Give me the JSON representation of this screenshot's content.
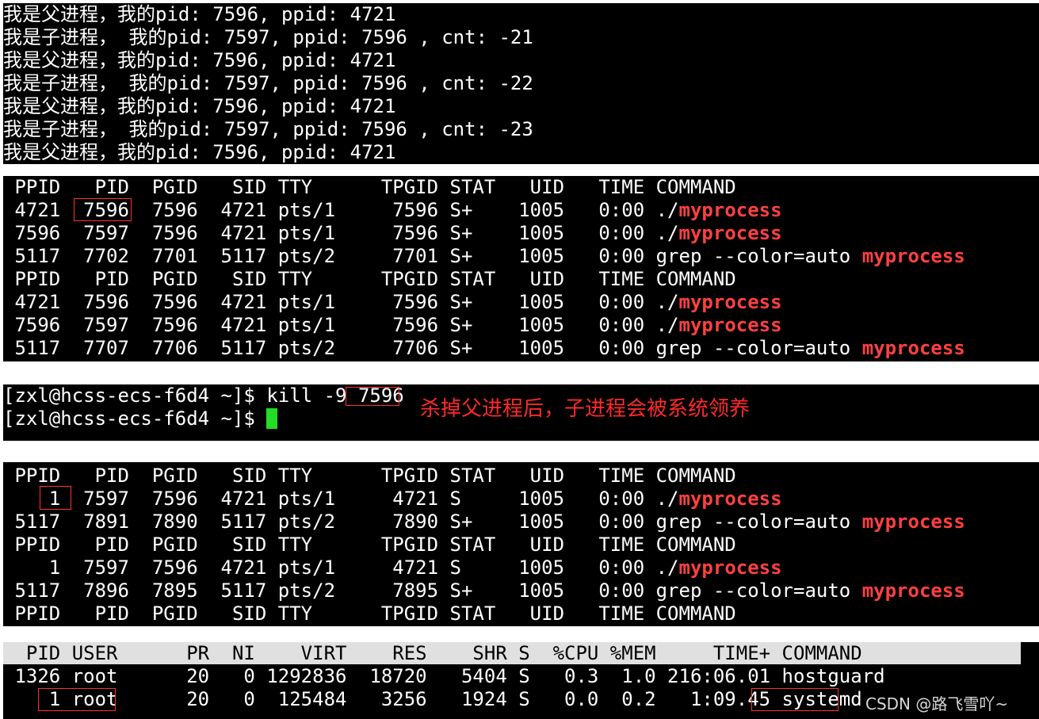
{
  "panel1": {
    "lines": [
      "我是父进程，我的pid: 7596, ppid: 4721",
      "我是子进程， 我的pid: 7597, ppid: 7596 , cnt: -21",
      "我是父进程，我的pid: 7596, ppid: 4721",
      "我是子进程， 我的pid: 7597, ppid: 7596 , cnt: -22",
      "我是父进程，我的pid: 7596, ppid: 4721",
      "我是子进程， 我的pid: 7597, ppid: 7596 , cnt: -23",
      "我是父进程，我的pid: 7596, ppid: 4721"
    ]
  },
  "ps": {
    "header": " PPID   PID  PGID   SID TTY      TPGID STAT   UID   TIME COMMAND",
    "cmd_prefix_run": "./",
    "cmd_prefix_grep": "grep --color=auto ",
    "highlight": "myprocess",
    "rows_before": [
      {
        "cols": " 4721  7596  7596  4721 pts/1     7596 S+    1005   0:00 ",
        "kind": "run"
      },
      {
        "cols": " 7596  7597  7596  4721 pts/1     7596 S+    1005   0:00 ",
        "kind": "run"
      },
      {
        "cols": " 5117  7702  7701  5117 pts/2     7701 S+    1005   0:00 ",
        "kind": "grep"
      },
      {
        "cols": " 4721  7596  7596  4721 pts/1     7596 S+    1005   0:00 ",
        "kind": "run"
      },
      {
        "cols": " 7596  7597  7596  4721 pts/1     7596 S+    1005   0:00 ",
        "kind": "run"
      },
      {
        "cols": " 5117  7707  7706  5117 pts/2     7706 S+    1005   0:00 ",
        "kind": "grep"
      }
    ],
    "rows_after": [
      {
        "cols": "    1  7597  7596  4721 pts/1     4721 S     1005   0:00 ",
        "kind": "run"
      },
      {
        "cols": " 5117  7891  7890  5117 pts/2     7890 S+    1005   0:00 ",
        "kind": "grep"
      },
      {
        "cols": "    1  7597  7596  4721 pts/1     4721 S     1005   0:00 ",
        "kind": "run"
      },
      {
        "cols": " 5117  7896  7895  5117 pts/2     7895 S+    1005   0:00 ",
        "kind": "grep"
      }
    ]
  },
  "shell": {
    "prompt": "[zxl@hcss-ecs-f6d4 ~]$ ",
    "command": "kill -9 ",
    "target_pid": "7596",
    "annotation": "杀掉父进程后，子进程会被系统领养"
  },
  "top": {
    "header": "  PID USER      PR  NI    VIRT    RES    SHR S  %CPU %MEM     TIME+ COMMAND",
    "row1": " 1326 root      20   0 1292836  18720   5404 S   0.3  1.0 216:06.01 hostguard",
    "row2_pre": "    1 root      20   0  125484   3256   1924 S   0.0  0.2   1:09.45 ",
    "row2_cmd": "systemd"
  },
  "watermark": "CSDN @路飞雪吖~"
}
